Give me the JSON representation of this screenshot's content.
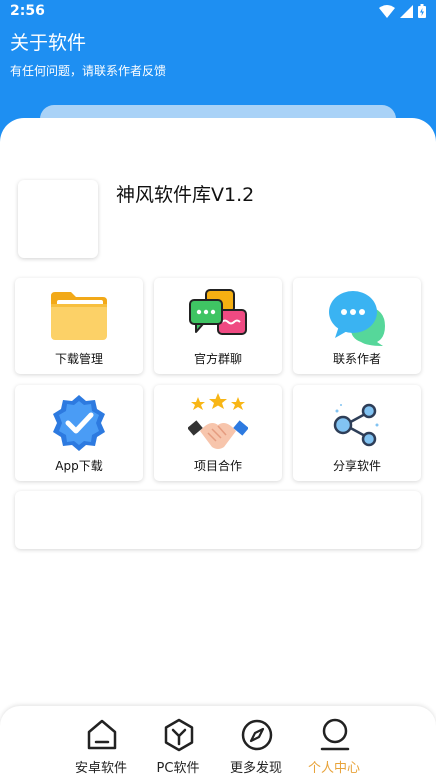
{
  "status_bar": {
    "time": "2:56"
  },
  "header": {
    "title": "关于软件",
    "subtitle": "有任何问题，请联系作者反馈"
  },
  "app_info": {
    "name": "神风软件库V1.2"
  },
  "tiles": [
    {
      "label": "下载管理",
      "icon": "folder-icon"
    },
    {
      "label": "官方群聊",
      "icon": "group-chat-icon"
    },
    {
      "label": "联系作者",
      "icon": "chat-bubble-icon"
    },
    {
      "label": "App下载",
      "icon": "verified-badge-icon"
    },
    {
      "label": "项目合作",
      "icon": "handshake-icon"
    },
    {
      "label": "分享软件",
      "icon": "share-icon"
    }
  ],
  "bottom_nav": [
    {
      "label": "安卓软件",
      "icon": "android-home-icon",
      "active": false
    },
    {
      "label": "PC软件",
      "icon": "hexagon-y-icon",
      "active": false
    },
    {
      "label": "更多发现",
      "icon": "compass-icon",
      "active": false
    },
    {
      "label": "个人中心",
      "icon": "person-icon",
      "active": true
    }
  ],
  "colors": {
    "brand_blue": "#1e8ff2",
    "active_tab": "#e8a33a"
  }
}
